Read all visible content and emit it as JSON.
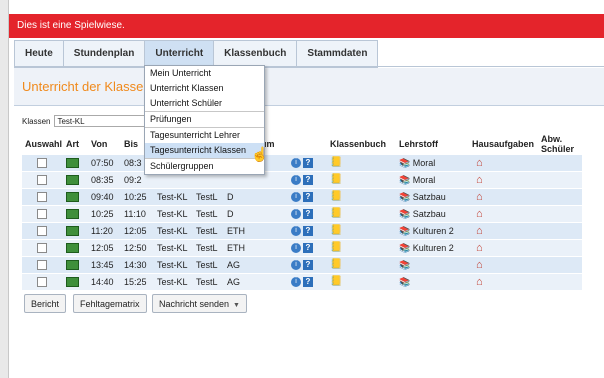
{
  "banner": "Dies ist eine Spielwiese.",
  "nav": [
    "Heute",
    "Stundenplan",
    "Unterricht",
    "Klassenbuch",
    "Stammdaten"
  ],
  "heading": "Unterricht der Klasse T",
  "klassen": {
    "label": "Klassen",
    "value": "Test-KL"
  },
  "columns": [
    "Auswahl",
    "Art",
    "Von",
    "Bis",
    "",
    "",
    "",
    "aum",
    "",
    "Klassenbuch",
    "Lehrstoff",
    "Hausaufgaben",
    "Abw. Schüler"
  ],
  "rows": [
    {
      "von": "07:50",
      "bis": "08:3",
      "klasse": "",
      "lehrer": "",
      "fach": "",
      "lehrstoff": "Moral"
    },
    {
      "von": "08:35",
      "bis": "09:2",
      "klasse": "",
      "lehrer": "",
      "fach": "",
      "lehrstoff": "Moral"
    },
    {
      "von": "09:40",
      "bis": "10:25",
      "klasse": "Test-KL",
      "lehrer": "TestL",
      "fach": "D",
      "lehrstoff": "Satzbau"
    },
    {
      "von": "10:25",
      "bis": "11:10",
      "klasse": "Test-KL",
      "lehrer": "TestL",
      "fach": "D",
      "lehrstoff": "Satzbau"
    },
    {
      "von": "11:20",
      "bis": "12:05",
      "klasse": "Test-KL",
      "lehrer": "TestL",
      "fach": "ETH",
      "lehrstoff": "Kulturen 2"
    },
    {
      "von": "12:05",
      "bis": "12:50",
      "klasse": "Test-KL",
      "lehrer": "TestL",
      "fach": "ETH",
      "lehrstoff": "Kulturen 2"
    },
    {
      "von": "13:45",
      "bis": "14:30",
      "klasse": "Test-KL",
      "lehrer": "TestL",
      "fach": "AG",
      "lehrstoff": ""
    },
    {
      "von": "14:40",
      "bis": "15:25",
      "klasse": "Test-KL",
      "lehrer": "TestL",
      "fach": "AG",
      "lehrstoff": ""
    }
  ],
  "menu": [
    "Mein Unterricht",
    "Unterricht Klassen",
    "Unterricht Schüler",
    "Prüfungen",
    "Tagesunterricht Lehrer",
    "Tagesunterricht Klassen",
    "Schülergruppen"
  ],
  "buttons": {
    "bericht": "Bericht",
    "fehltage": "Fehltagematrix",
    "nachricht": "Nachricht senden"
  },
  "colors": {
    "banner": "#e4242b",
    "heading": "#f08a1c",
    "row": "#dde9f6",
    "menu_highlight": "#cde0f5"
  }
}
